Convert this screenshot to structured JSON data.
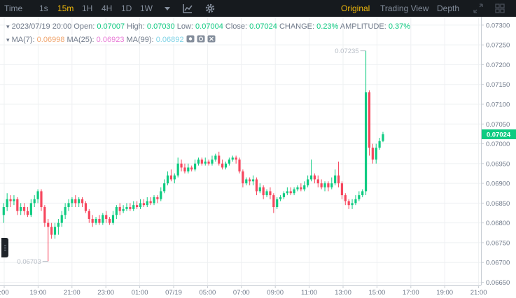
{
  "toolbar": {
    "intervals": [
      "Time",
      "1s",
      "15m",
      "1H",
      "4H",
      "1D",
      "1W"
    ],
    "active_interval": "15m",
    "views": [
      "Original",
      "Trading View",
      "Depth"
    ],
    "active_view": "Original",
    "icons": [
      "dropdown-caret-icon",
      "indicator-chart-icon",
      "settings-gear-icon",
      "fullscreen-icon",
      "grid-layout-icon"
    ]
  },
  "ohlc": {
    "datetime": "2023/07/19 20:00",
    "open_label": "Open:",
    "open": "0.07007",
    "high_label": "High:",
    "high": "0.07030",
    "low_label": "Low:",
    "low": "0.07004",
    "close_label": "Close:",
    "close": "0.07024",
    "change_label": "CHANGE:",
    "change": "0.23%",
    "amplitude_label": "AMPLITUDE:",
    "amplitude": "0.37%"
  },
  "ma": {
    "ma7_label": "MA(7):",
    "ma7": "0.06998",
    "ma25_label": "MA(25):",
    "ma25": "0.06923",
    "ma99_label": "MA(99):",
    "ma99": "0.06892"
  },
  "colors": {
    "up": "#0ecb81",
    "down": "#f6465d",
    "ma7": "#f0a56e",
    "ma25": "#e87ad6",
    "ma99": "#7fd3e6",
    "toolbar_bg": "#161a1e",
    "active": "#f0b90b"
  },
  "chart_data": {
    "type": "candlestick",
    "ylim": [
      0.06642,
      0.07321
    ],
    "y_ticks": [
      "0.07300",
      "0.07250",
      "0.07200",
      "0.07150",
      "0.07100",
      "0.07050",
      "0.07000",
      "0.06950",
      "0.06900",
      "0.06850",
      "0.06800",
      "0.06750",
      "0.06700",
      "0.06650"
    ],
    "x_ticks": [
      ":00",
      "19:00",
      "21:00",
      "23:00",
      "01:00",
      "07/19",
      "05:00",
      "07:00",
      "09:00",
      "11:00",
      "13:00",
      "15:00",
      "17:00",
      "19:00",
      "21:00"
    ],
    "last_price": "0.07024",
    "max_label": "0.07235",
    "min_label": "0.06703",
    "candles": [
      [
        0.0682,
        0.0684,
        0.0685,
        0.068
      ],
      [
        0.0684,
        0.0686,
        0.06875,
        0.0683
      ],
      [
        0.0686,
        0.06855,
        0.0687,
        0.0684
      ],
      [
        0.06855,
        0.0686,
        0.0687,
        0.06845
      ],
      [
        0.0686,
        0.0683,
        0.06865,
        0.0682
      ],
      [
        0.0683,
        0.0684,
        0.0685,
        0.0682
      ],
      [
        0.0684,
        0.0683,
        0.0685,
        0.0682
      ],
      [
        0.0683,
        0.0682,
        0.0684,
        0.06815
      ],
      [
        0.0682,
        0.0685,
        0.0686,
        0.06815
      ],
      [
        0.0685,
        0.0686,
        0.0687,
        0.0684
      ],
      [
        0.0686,
        0.0688,
        0.06885,
        0.0685
      ],
      [
        0.0688,
        0.0684,
        0.06885,
        0.0683
      ],
      [
        0.0684,
        0.068,
        0.06845,
        0.0679
      ],
      [
        0.068,
        0.0679,
        0.0681,
        0.06703
      ],
      [
        0.0679,
        0.0677,
        0.068,
        0.0676
      ],
      [
        0.0677,
        0.0679,
        0.068,
        0.0676
      ],
      [
        0.0679,
        0.068,
        0.0681,
        0.0677
      ],
      [
        0.068,
        0.0682,
        0.0683,
        0.0679
      ],
      [
        0.0682,
        0.0684,
        0.0685,
        0.0681
      ],
      [
        0.0684,
        0.0685,
        0.0686,
        0.0683
      ],
      [
        0.0685,
        0.0686,
        0.06865,
        0.0684
      ],
      [
        0.0686,
        0.0685,
        0.0687,
        0.0684
      ],
      [
        0.0685,
        0.0686,
        0.06865,
        0.0684
      ],
      [
        0.0686,
        0.0685,
        0.06865,
        0.0684
      ],
      [
        0.0685,
        0.0683,
        0.06855,
        0.06825
      ],
      [
        0.0683,
        0.0681,
        0.06835,
        0.068
      ],
      [
        0.0681,
        0.068,
        0.0682,
        0.0679
      ],
      [
        0.068,
        0.0681,
        0.06815,
        0.06795
      ],
      [
        0.0681,
        0.068,
        0.0682,
        0.06795
      ],
      [
        0.068,
        0.0682,
        0.06825,
        0.06795
      ],
      [
        0.0682,
        0.0681,
        0.0683,
        0.068
      ],
      [
        0.0681,
        0.068,
        0.06815,
        0.06795
      ],
      [
        0.068,
        0.0682,
        0.0683,
        0.06795
      ],
      [
        0.0682,
        0.0684,
        0.06845,
        0.0681
      ],
      [
        0.0684,
        0.0683,
        0.0685,
        0.0682
      ],
      [
        0.0683,
        0.06835,
        0.06845,
        0.06825
      ],
      [
        0.06835,
        0.0684,
        0.0685,
        0.0683
      ],
      [
        0.0684,
        0.06835,
        0.0685,
        0.0683
      ],
      [
        0.06835,
        0.06845,
        0.06855,
        0.0683
      ],
      [
        0.06845,
        0.0684,
        0.06855,
        0.06835
      ],
      [
        0.0684,
        0.0685,
        0.0686,
        0.06835
      ],
      [
        0.0685,
        0.06845,
        0.0686,
        0.0684
      ],
      [
        0.06845,
        0.06855,
        0.06865,
        0.0684
      ],
      [
        0.06855,
        0.0685,
        0.06865,
        0.06845
      ],
      [
        0.0685,
        0.06865,
        0.0687,
        0.06845
      ],
      [
        0.06865,
        0.0686,
        0.0687,
        0.0685
      ],
      [
        0.0686,
        0.0688,
        0.0689,
        0.06855
      ],
      [
        0.0688,
        0.069,
        0.0691,
        0.06875
      ],
      [
        0.069,
        0.0692,
        0.0693,
        0.06895
      ],
      [
        0.0692,
        0.0691,
        0.06935,
        0.06905
      ],
      [
        0.0691,
        0.0692,
        0.06925,
        0.069
      ],
      [
        0.0692,
        0.0695,
        0.06965,
        0.06915
      ],
      [
        0.0695,
        0.0694,
        0.0696,
        0.0693
      ],
      [
        0.0694,
        0.0693,
        0.0695,
        0.06925
      ],
      [
        0.0693,
        0.0694,
        0.0695,
        0.06925
      ],
      [
        0.0694,
        0.06935,
        0.06945,
        0.0693
      ],
      [
        0.06935,
        0.0695,
        0.0696,
        0.0693
      ],
      [
        0.0695,
        0.0696,
        0.06965,
        0.06945
      ],
      [
        0.0696,
        0.0695,
        0.06965,
        0.06945
      ],
      [
        0.0695,
        0.06955,
        0.06965,
        0.06945
      ],
      [
        0.06955,
        0.0695,
        0.0696,
        0.06945
      ],
      [
        0.0695,
        0.0696,
        0.0697,
        0.06945
      ],
      [
        0.0696,
        0.0697,
        0.06975,
        0.06955
      ],
      [
        0.0697,
        0.0695,
        0.0698,
        0.06945
      ],
      [
        0.0695,
        0.0694,
        0.0696,
        0.06935
      ],
      [
        0.0694,
        0.0695,
        0.06955,
        0.06935
      ],
      [
        0.0695,
        0.0696,
        0.06965,
        0.06945
      ],
      [
        0.0696,
        0.06965,
        0.0697,
        0.06955
      ],
      [
        0.06965,
        0.0696,
        0.0697,
        0.0695
      ],
      [
        0.0696,
        0.0693,
        0.06965,
        0.06925
      ],
      [
        0.0693,
        0.069,
        0.06935,
        0.0689
      ],
      [
        0.069,
        0.0691,
        0.06915,
        0.06895
      ],
      [
        0.0691,
        0.06905,
        0.06915,
        0.06895
      ],
      [
        0.06905,
        0.0691,
        0.0692,
        0.06895
      ],
      [
        0.0691,
        0.0688,
        0.06915,
        0.0687
      ],
      [
        0.0688,
        0.0689,
        0.069,
        0.06875
      ],
      [
        0.0689,
        0.0687,
        0.06895,
        0.0686
      ],
      [
        0.0687,
        0.0688,
        0.06885,
        0.06865
      ],
      [
        0.0688,
        0.0687,
        0.0689,
        0.0686
      ],
      [
        0.0687,
        0.0684,
        0.06875,
        0.06825
      ],
      [
        0.0684,
        0.0686,
        0.06865,
        0.06835
      ],
      [
        0.0686,
        0.06865,
        0.0687,
        0.06855
      ],
      [
        0.06865,
        0.06875,
        0.0688,
        0.0686
      ],
      [
        0.06875,
        0.0688,
        0.0689,
        0.0687
      ],
      [
        0.0688,
        0.06875,
        0.0689,
        0.0687
      ],
      [
        0.06875,
        0.06885,
        0.0689,
        0.0687
      ],
      [
        0.06885,
        0.0689,
        0.06895,
        0.0688
      ],
      [
        0.0689,
        0.06885,
        0.069,
        0.0688
      ],
      [
        0.06885,
        0.06895,
        0.06905,
        0.0688
      ],
      [
        0.06895,
        0.0691,
        0.0692,
        0.0689
      ],
      [
        0.0691,
        0.0692,
        0.0696,
        0.06905
      ],
      [
        0.0692,
        0.0691,
        0.06925,
        0.069
      ],
      [
        0.0691,
        0.069,
        0.0692,
        0.0689
      ],
      [
        0.069,
        0.0689,
        0.0691,
        0.06885
      ],
      [
        0.0689,
        0.069,
        0.06905,
        0.0688
      ],
      [
        0.069,
        0.0689,
        0.06905,
        0.0688
      ],
      [
        0.0689,
        0.069,
        0.06915,
        0.06885
      ],
      [
        0.069,
        0.0692,
        0.06935,
        0.06895
      ],
      [
        0.0692,
        0.069,
        0.06955,
        0.0689
      ],
      [
        0.069,
        0.0687,
        0.06905,
        0.0686
      ],
      [
        0.0687,
        0.06855,
        0.06875,
        0.06845
      ],
      [
        0.06855,
        0.06845,
        0.0686,
        0.06835
      ],
      [
        0.06845,
        0.0685,
        0.0686,
        0.06835
      ],
      [
        0.0685,
        0.0686,
        0.0687,
        0.06845
      ],
      [
        0.0686,
        0.0687,
        0.0688,
        0.06855
      ],
      [
        0.0687,
        0.0688,
        0.06885,
        0.06865
      ],
      [
        0.0688,
        0.0713,
        0.07235,
        0.0687
      ],
      [
        0.0713,
        0.0699,
        0.07135,
        0.0697
      ],
      [
        0.0699,
        0.0696,
        0.07,
        0.0695
      ],
      [
        0.0696,
        0.0699,
        0.07,
        0.0695
      ],
      [
        0.0699,
        0.07007,
        0.07015,
        0.06985
      ],
      [
        0.07007,
        0.07024,
        0.0703,
        0.07004
      ]
    ]
  }
}
